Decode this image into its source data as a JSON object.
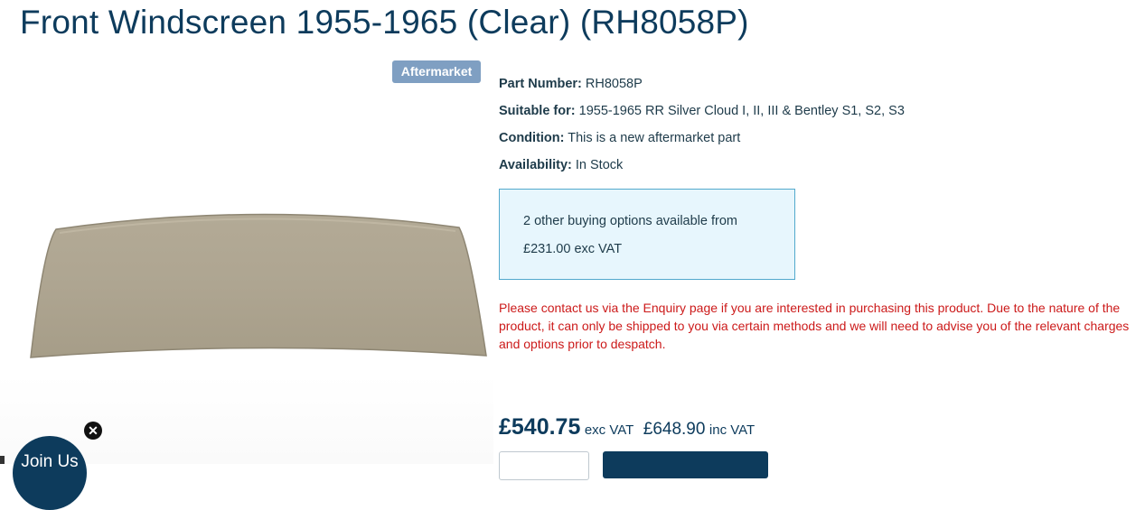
{
  "product": {
    "title": "Front Windscreen 1955-1965 (Clear) (RH8058P)",
    "badge": "Aftermarket"
  },
  "specs": [
    {
      "label": "Part Number:",
      "value": "RH8058P"
    },
    {
      "label": "Suitable for:",
      "value": "1955-1965 RR Silver Cloud I, II, III & Bentley S1, S2, S3"
    },
    {
      "label": "Condition:",
      "value": "This is a new aftermarket part"
    },
    {
      "label": "Availability:",
      "value": "In Stock"
    }
  ],
  "buying_options": {
    "line1": "2 other buying options available from",
    "line2": "£231.00 exc VAT"
  },
  "notice": "Please contact us via the Enquiry page if you are interested in purchasing this product. Due to the nature of the product, it can only be shipped to you via certain methods and we will need to advise you of the relevant charges and options prior to despatch.",
  "price": {
    "exc": "£540.75",
    "exc_label": "exc VAT",
    "inc": "£648.90",
    "inc_label": "inc VAT"
  },
  "join": {
    "label": "Join Us",
    "close_icon": "close-icon"
  },
  "colors": {
    "brand": "#0d3b5c",
    "badge": "#7f9fc2",
    "notice": "#cc1a1a",
    "options_bg": "#e7f6fd",
    "options_border": "#52a9cd"
  }
}
